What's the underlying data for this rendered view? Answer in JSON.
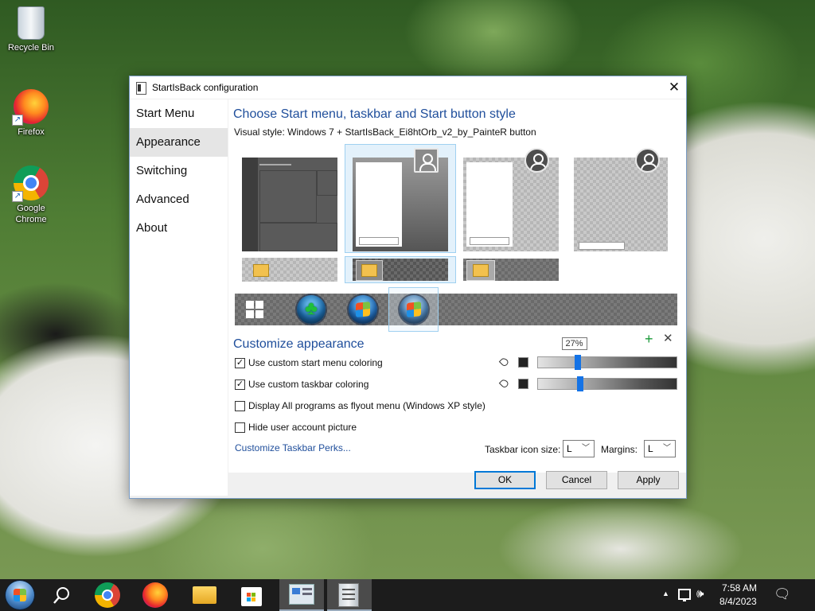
{
  "desktop": {
    "icons": [
      {
        "label": "Recycle Bin"
      },
      {
        "label": "Firefox"
      },
      {
        "label": "Google Chrome"
      }
    ]
  },
  "dialog": {
    "title": "StartIsBack configuration",
    "close_glyph": "✕",
    "nav": [
      {
        "label": "Start Menu",
        "active": false
      },
      {
        "label": "Appearance",
        "active": true
      },
      {
        "label": "Switching",
        "active": false
      },
      {
        "label": "Advanced",
        "active": false
      },
      {
        "label": "About",
        "active": false
      }
    ],
    "style_heading": "Choose Start menu, taskbar and Start button style",
    "visual_style": "Visual style:  Windows 7 + StartIsBack_Ei8htOrb_v2_by_PainteR button",
    "customize_heading": "Customize appearance",
    "options": [
      {
        "label": "Use custom start menu coloring",
        "checked": true
      },
      {
        "label": "Use custom taskbar coloring",
        "checked": true
      },
      {
        "label": "Display All programs as flyout menu (Windows XP style)",
        "checked": false
      },
      {
        "label": "Hide user account picture",
        "checked": false
      }
    ],
    "check_glyph": "✓",
    "start_menu_opacity": {
      "value": 0.27,
      "tooltip": "27%"
    },
    "taskbar_opacity": {
      "value": 0.29
    },
    "perks_link": "Customize Taskbar Perks...",
    "icon_size_label": "Taskbar icon size:",
    "icon_size_value": "L",
    "margins_label": "Margins:",
    "margins_value": "L",
    "buttons": {
      "ok": "OK",
      "cancel": "Cancel",
      "apply": "Apply"
    },
    "add_glyph": "+",
    "remove_glyph": "✕"
  },
  "taskbar": {
    "time": "7:58 AM",
    "date": "8/4/2023",
    "tray_chevron": "▲",
    "speaker_glyph": "🕪",
    "notification_glyph": "🗨",
    "apps": [
      "search-icon",
      "chrome-icon",
      "firefox-icon",
      "file-explorer-icon",
      "store-icon",
      "startisback-config-icon",
      "server-icon"
    ]
  }
}
